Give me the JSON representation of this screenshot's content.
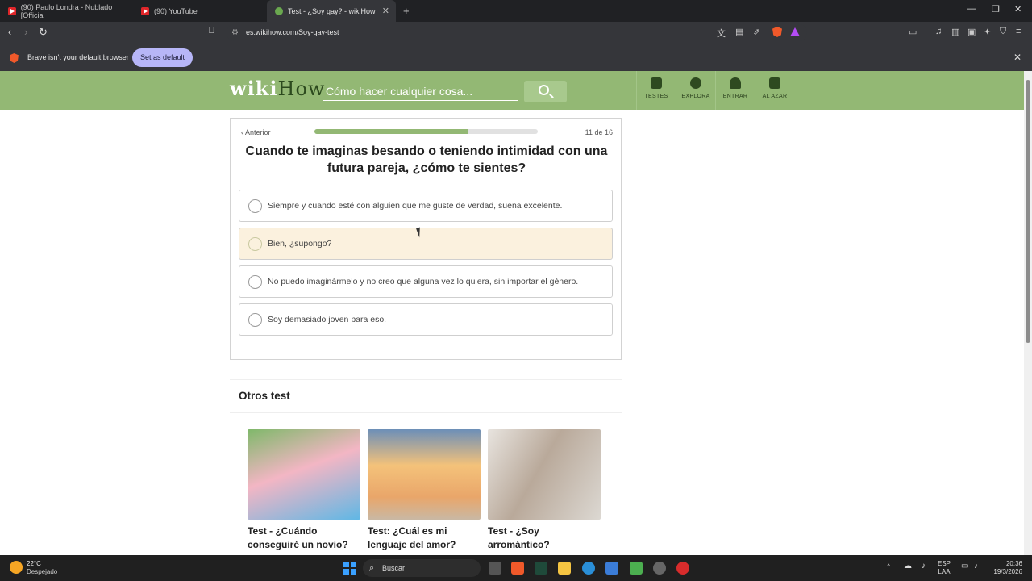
{
  "browser": {
    "tabs": [
      {
        "title": "(90) Paulo Londra - Nublado [Officia",
        "active": false
      },
      {
        "title": "(90) YouTube",
        "active": false
      },
      {
        "title": "Test - ¿Soy gay? - wikiHow",
        "active": true
      }
    ],
    "url": "es.wikihow.com/Soy-gay-test",
    "infobar": {
      "message": "Brave isn't your default browser",
      "button": "Set as default"
    }
  },
  "header": {
    "logo_left": "wiki",
    "logo_right": "How",
    "search_placeholder": "Cómo hacer cualquier cosa...",
    "nav": [
      "TESTES",
      "EXPLORA",
      "ENTRAR",
      "AL AZAR"
    ]
  },
  "quiz": {
    "prev_label": "Anterior",
    "counter": "11 de 16",
    "progress_fraction": 0.69,
    "question": "Cuando te imaginas besando o teniendo intimidad con una futura pareja, ¿cómo te sientes?",
    "options": [
      "Siempre y cuando esté con alguien que me guste de verdad, suena excelente.",
      "Bien, ¿supongo?",
      "No puedo imaginármelo y no creo que alguna vez lo quiera, sin importar el género.",
      "Soy demasiado joven para eso."
    ]
  },
  "otros": {
    "title": "Otros test",
    "items": [
      {
        "title": "Test - ¿Cuándo conseguiré un novio?"
      },
      {
        "title": "Test: ¿Cuál es mi lenguaje del amor?"
      },
      {
        "title": "Test - ¿Soy arromántico?"
      }
    ]
  },
  "taskbar": {
    "weather_temp": "22°C",
    "weather_desc": "Despejado",
    "search_label": "Buscar",
    "lang_top": "ESP",
    "lang_bottom": "LAA",
    "time": "20:36",
    "date": "19/3/2026"
  },
  "colors": {
    "wikihow_green": "#93b874",
    "hover_option": "#fbf1de",
    "brave_accent": "#b7b6f7"
  }
}
